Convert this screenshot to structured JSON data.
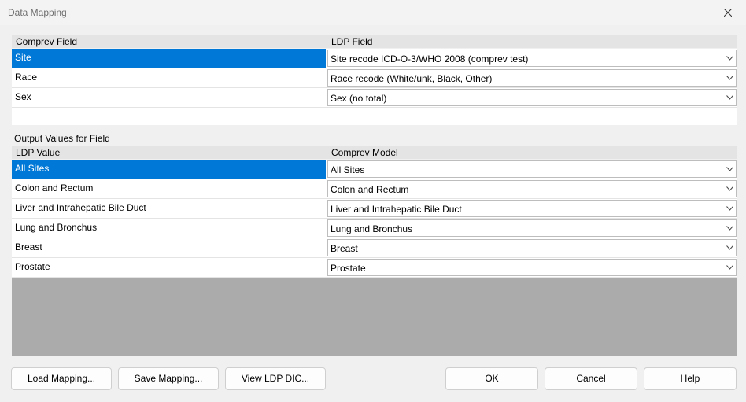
{
  "window": {
    "title": "Data Mapping"
  },
  "field_mapping": {
    "headers": [
      "Comprev Field",
      "LDP Field"
    ],
    "rows": [
      {
        "field": "Site",
        "ldp": "Site recode ICD-O-3/WHO 2008 (comprev test)",
        "selected": true
      },
      {
        "field": "Race",
        "ldp": "Race recode (White/unk, Black, Other)",
        "selected": false
      },
      {
        "field": "Sex",
        "ldp": "Sex (no total)",
        "selected": false
      }
    ]
  },
  "output_values": {
    "section_label": "Output Values for Field",
    "headers": [
      "LDP Value",
      "Comprev Model"
    ],
    "rows": [
      {
        "ldp_value": "All Sites",
        "model": "All Sites",
        "selected": true
      },
      {
        "ldp_value": "Colon and Rectum",
        "model": "Colon and Rectum",
        "selected": false
      },
      {
        "ldp_value": "Liver and Intrahepatic Bile Duct",
        "model": "Liver and Intrahepatic Bile Duct",
        "selected": false
      },
      {
        "ldp_value": "Lung and Bronchus",
        "model": "Lung and Bronchus",
        "selected": false
      },
      {
        "ldp_value": "Breast",
        "model": "Breast",
        "selected": false
      },
      {
        "ldp_value": "Prostate",
        "model": "Prostate",
        "selected": false
      }
    ]
  },
  "buttons": {
    "load": "Load Mapping...",
    "save": "Save Mapping...",
    "view": "View LDP DIC...",
    "ok": "OK",
    "cancel": "Cancel",
    "help": "Help"
  },
  "colors": {
    "selection": "#0078d7",
    "empty_area": "#ababab"
  }
}
